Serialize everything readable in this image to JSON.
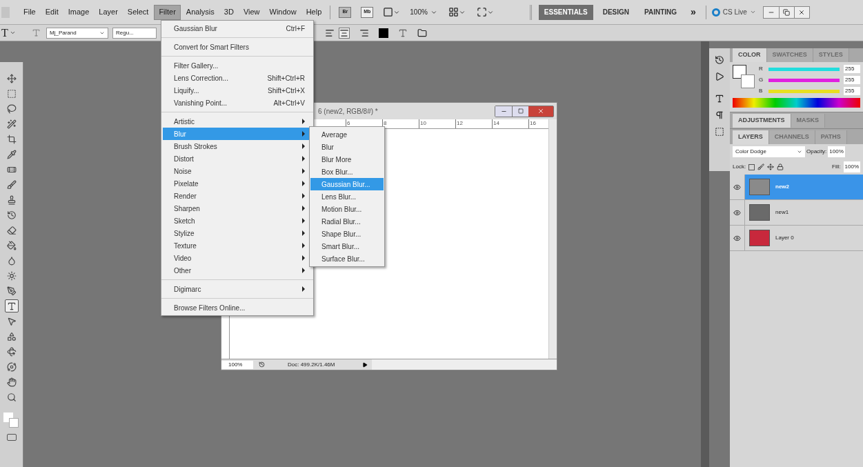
{
  "menubar": {
    "items": [
      {
        "label": "File",
        "selected": false
      },
      {
        "label": "Edit",
        "selected": false
      },
      {
        "label": "Image",
        "selected": false
      },
      {
        "label": "Layer",
        "selected": false
      },
      {
        "label": "Select",
        "selected": false
      },
      {
        "label": "Filter",
        "selected": true
      },
      {
        "label": "Analysis",
        "selected": false
      },
      {
        "label": "3D",
        "selected": false
      },
      {
        "label": "View",
        "selected": false
      },
      {
        "label": "Window",
        "selected": false
      },
      {
        "label": "Help",
        "selected": false
      }
    ],
    "bridge_button": "Br",
    "mini_bridge_button": "Mb",
    "zoom": "100%",
    "workspaces": [
      {
        "label": "ESSENTIALS",
        "selected": true
      },
      {
        "label": "DESIGN",
        "selected": false
      },
      {
        "label": "PAINTING",
        "selected": false
      }
    ],
    "more": "»",
    "cs_live": "CS Live"
  },
  "options_bar": {
    "tool": "T",
    "font_family": "Mj_Parand",
    "font_style": "Regu..."
  },
  "tools": [
    {
      "kind": "move",
      "selected": false
    },
    {
      "kind": "marquee",
      "selected": false
    },
    {
      "kind": "lasso",
      "selected": false
    },
    {
      "kind": "wand",
      "selected": false
    },
    {
      "kind": "crop",
      "selected": false
    },
    {
      "kind": "eyedropper",
      "selected": false
    },
    {
      "kind": "heal",
      "selected": false
    },
    {
      "kind": "brush",
      "selected": false
    },
    {
      "kind": "stamp",
      "selected": false
    },
    {
      "kind": "history",
      "selected": false
    },
    {
      "kind": "eraser",
      "selected": false
    },
    {
      "kind": "bucket",
      "selected": false
    },
    {
      "kind": "blur",
      "selected": false
    },
    {
      "kind": "dodge",
      "selected": false
    },
    {
      "kind": "pen",
      "selected": false
    },
    {
      "kind": "type",
      "selected": true
    },
    {
      "kind": "select",
      "selected": false
    },
    {
      "kind": "shape",
      "selected": false
    },
    {
      "kind": "rotate",
      "selected": false
    },
    {
      "kind": "orbit",
      "selected": false
    },
    {
      "kind": "hand",
      "selected": false
    },
    {
      "kind": "zoom",
      "selected": false
    }
  ],
  "filter_menu": {
    "sections": [
      [
        {
          "label": "Gaussian Blur",
          "shortcut": "Ctrl+F",
          "submenu": false,
          "selected": false
        }
      ],
      [
        {
          "label": "Convert for Smart Filters",
          "submenu": false,
          "selected": false
        }
      ],
      [
        {
          "label": "Filter Gallery...",
          "submenu": false,
          "selected": false
        },
        {
          "label": "Lens Correction...",
          "shortcut": "Shift+Ctrl+R",
          "submenu": false,
          "selected": false
        },
        {
          "label": "Liquify...",
          "shortcut": "Shift+Ctrl+X",
          "submenu": false,
          "selected": false
        },
        {
          "label": "Vanishing Point...",
          "shortcut": "Alt+Ctrl+V",
          "submenu": false,
          "selected": false
        }
      ],
      [
        {
          "label": "Artistic",
          "submenu": true,
          "selected": false
        },
        {
          "label": "Blur",
          "submenu": true,
          "selected": true
        },
        {
          "label": "Brush Strokes",
          "submenu": true,
          "selected": false
        },
        {
          "label": "Distort",
          "submenu": true,
          "selected": false
        },
        {
          "label": "Noise",
          "submenu": true,
          "selected": false
        },
        {
          "label": "Pixelate",
          "submenu": true,
          "selected": false
        },
        {
          "label": "Render",
          "submenu": true,
          "selected": false
        },
        {
          "label": "Sharpen",
          "submenu": true,
          "selected": false
        },
        {
          "label": "Sketch",
          "submenu": true,
          "selected": false
        },
        {
          "label": "Stylize",
          "submenu": true,
          "selected": false
        },
        {
          "label": "Texture",
          "submenu": true,
          "selected": false
        },
        {
          "label": "Video",
          "submenu": true,
          "selected": false
        },
        {
          "label": "Other",
          "submenu": true,
          "selected": false
        }
      ],
      [
        {
          "label": "Digimarc",
          "submenu": true,
          "selected": false
        }
      ],
      [
        {
          "label": "Browse Filters Online...",
          "submenu": false,
          "selected": false
        }
      ]
    ]
  },
  "blur_submenu": [
    {
      "label": "Average",
      "selected": false
    },
    {
      "label": "Blur",
      "selected": false
    },
    {
      "label": "Blur More",
      "selected": false
    },
    {
      "label": "Box Blur...",
      "selected": false
    },
    {
      "label": "Gaussian Blur...",
      "selected": true
    },
    {
      "label": "Lens Blur...",
      "selected": false
    },
    {
      "label": "Motion Blur...",
      "selected": false
    },
    {
      "label": "Radial Blur...",
      "selected": false
    },
    {
      "label": "Shape Blur...",
      "selected": false
    },
    {
      "label": "Smart Blur...",
      "selected": false
    },
    {
      "label": "Surface Blur...",
      "selected": false
    }
  ],
  "document": {
    "title": "6 (new2, RGB/8#) *",
    "ruler_marks": [
      "6",
      "8",
      "10",
      "12",
      "14",
      "16"
    ],
    "zoom": "100%",
    "doc_info": "Doc: 499.2K/1.46M"
  },
  "color_panel": {
    "tabs": [
      {
        "label": "COLOR",
        "selected": true
      },
      {
        "label": "SWATCHES",
        "selected": false
      },
      {
        "label": "STYLES",
        "selected": false
      }
    ],
    "channels": [
      {
        "name": "R",
        "level": 1,
        "value": "255",
        "color": "#22dddd"
      },
      {
        "name": "G",
        "level": 1,
        "value": "255",
        "color": "#e020e0"
      },
      {
        "name": "B",
        "level": 1,
        "value": "255",
        "color": "#e8e020"
      }
    ]
  },
  "adjustments_tabs": [
    {
      "label": "ADJUSTMENTS",
      "selected": true
    },
    {
      "label": "MASKS",
      "selected": false
    }
  ],
  "layers_panel": {
    "tabs": [
      {
        "label": "LAYERS",
        "selected": true
      },
      {
        "label": "CHANNELS",
        "selected": false
      },
      {
        "label": "PATHS",
        "selected": false
      }
    ],
    "blend_mode": "Color Dodge",
    "opacity_label": "Opacity:",
    "opacity": "100%",
    "lock_label": "Lock:",
    "fill_label": "Fill:",
    "fill": "100%",
    "layers": [
      {
        "name": "new2",
        "selected": true,
        "color": "#8a8a8a"
      },
      {
        "name": "new1",
        "selected": false,
        "color": "#6a6a6a"
      },
      {
        "name": "Layer 0",
        "selected": false,
        "color": "#c8283c"
      }
    ]
  }
}
